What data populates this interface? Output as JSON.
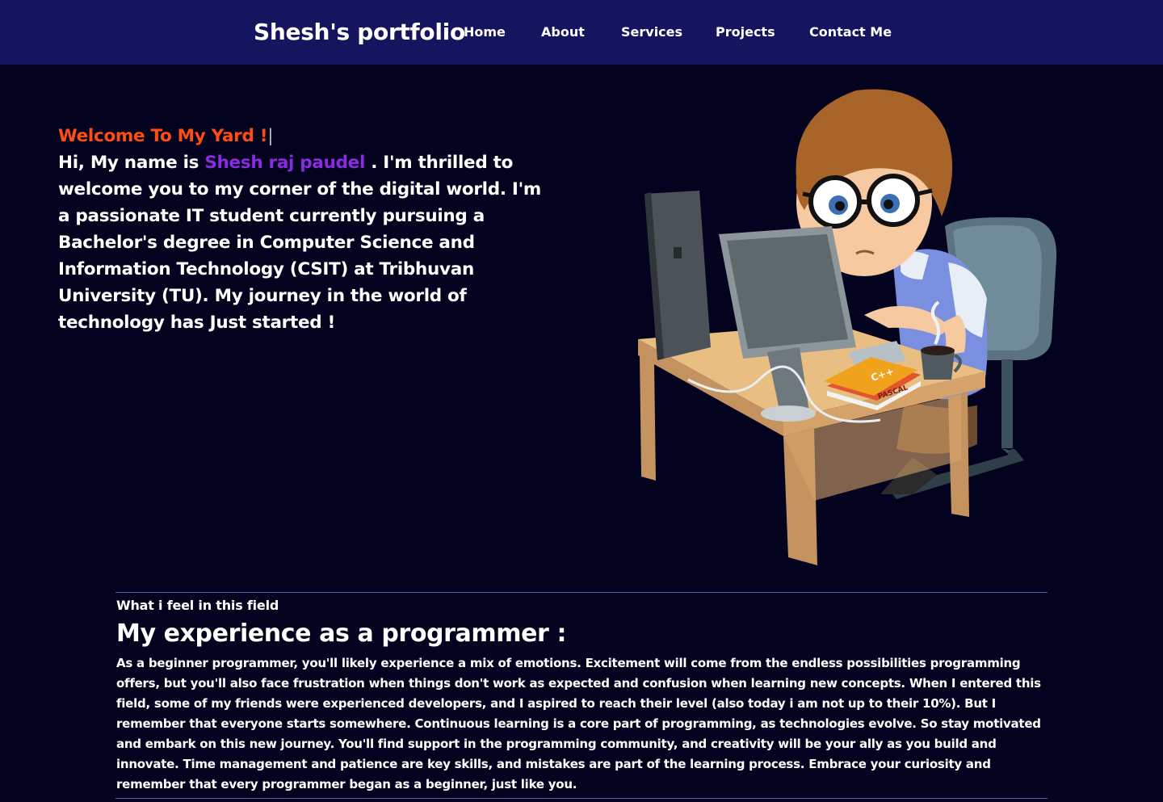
{
  "nav": {
    "brand": "Shesh's portfolio",
    "links": [
      "Home",
      "About",
      "Services",
      "Projects",
      "Contact Me"
    ]
  },
  "hero": {
    "welcome": "Welcome To My Yard !",
    "cursor": "|",
    "intro_prefix": "Hi, My name is ",
    "name": "Shesh raj paudel",
    "intro_body": " . I'm thrilled to welcome you to my corner of the digital world. I'm a passionate IT student currently pursuing a Bachelor's degree in Computer Science and Information Technology (CSIT) at Tribhuvan University (TU). My journey in the world of technology has Just started !",
    "illustration": "programmer-at-computer-illustration",
    "book_labels": [
      "C++",
      "PASCAL"
    ]
  },
  "experience": {
    "kicker": "What i feel in this field",
    "title": "My experience as a programmer :",
    "body": "As a beginner programmer, you'll likely experience a mix of emotions. Excitement will come from the endless possibilities programming offers, but you'll also face frustration when things don't work as expected and confusion when learning new concepts. When I entered this field, some of my friends were experienced developers, and I aspired to reach their level (also today i am not up to their 10%). But I remember that everyone starts somewhere. Continuous learning is a core part of programming, as technologies evolve. So stay motivated and embark on this new journey. You'll find support in the programming community, and creativity will be your ally as you build and innovate. Time management and patience are key skills, and mistakes are part of the learning process. Embrace your curiosity and remember that every programmer began as a beginner, just like you."
  },
  "colors": {
    "background": "#03031f",
    "navbar": "#14155e",
    "welcome": "#ff4d14",
    "name": "#8a2be2",
    "text": "#ffffff"
  }
}
